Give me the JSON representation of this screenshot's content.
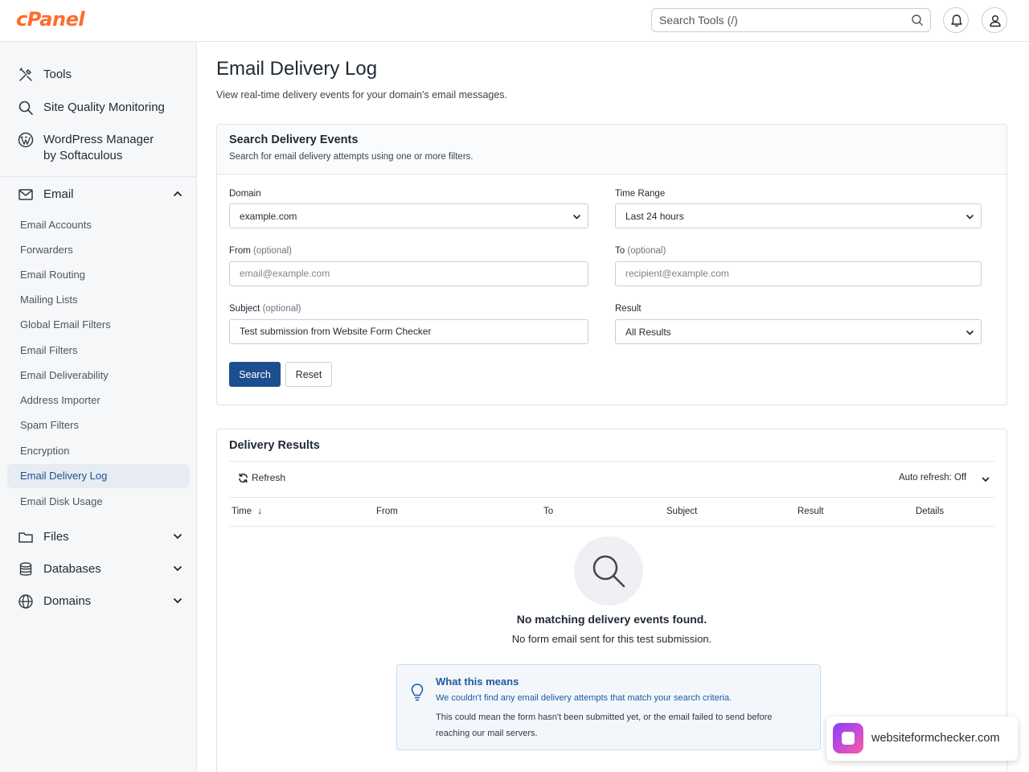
{
  "header": {
    "logo": "cPanel",
    "search_placeholder": "Search Tools (/)"
  },
  "sidebar": {
    "top_items": [
      {
        "label": "Tools",
        "icon": "tools-icon"
      },
      {
        "label": "Site Quality Monitoring",
        "icon": "search-icon"
      },
      {
        "label": "WordPress Manager by Softaculous",
        "line1": "WordPress Manager",
        "line2": "by Softaculous",
        "icon": "wordpress-icon"
      }
    ],
    "email_section": {
      "label": "Email",
      "expanded": true,
      "items": [
        "Email Accounts",
        "Forwarders",
        "Email Routing",
        "Mailing Lists",
        "Global Email Filters",
        "Email Filters",
        "Email Deliverability",
        "Address Importer",
        "Spam Filters",
        "Encryption",
        "Email Delivery Log",
        "Email Disk Usage"
      ],
      "active": "Email Delivery Log"
    },
    "sections": [
      {
        "label": "Files",
        "icon": "folder-icon"
      },
      {
        "label": "Databases",
        "icon": "database-icon"
      },
      {
        "label": "Domains",
        "icon": "globe-icon"
      }
    ]
  },
  "main": {
    "title": "Email Delivery Log",
    "description": "View real-time delivery events for your domain's email messages."
  },
  "search_card": {
    "title": "Search Delivery Events",
    "subtitle": "Search for email delivery attempts using one or more filters.",
    "domain": {
      "label": "Domain",
      "value": "example.com"
    },
    "time_range": {
      "label": "Time Range",
      "value": "Last 24 hours"
    },
    "from": {
      "label": "From",
      "optional": "(optional)",
      "placeholder": "email@example.com"
    },
    "to": {
      "label": "To",
      "optional": "(optional)",
      "placeholder": "recipient@example.com"
    },
    "subject": {
      "label": "Subject",
      "optional": "(optional)",
      "value": "Test submission from Website Form Checker"
    },
    "result": {
      "label": "Result",
      "value": "All Results"
    },
    "search_button": "Search",
    "reset_button": "Reset"
  },
  "results_card": {
    "title": "Delivery Results",
    "refresh": "Refresh",
    "auto_refresh": "Auto refresh: Off",
    "columns": [
      "Time",
      "From",
      "To",
      "Subject",
      "Result",
      "Details"
    ],
    "sort_indicator": "↓",
    "empty_title": "No matching delivery events found.",
    "empty_subtitle": "No form email sent for this test submission.",
    "info": {
      "title": "What this means",
      "line1": "We couldn't find any email delivery attempts that match your search criteria.",
      "line2": "This could mean the form hasn't been submitted yet, or the email failed to send before reaching our mail servers."
    }
  },
  "badge": {
    "text": "websiteformchecker.com"
  },
  "colors": {
    "accent": "#1d4e8f",
    "logo": "#ff6c2c",
    "info_title": "#1d5aa0"
  }
}
